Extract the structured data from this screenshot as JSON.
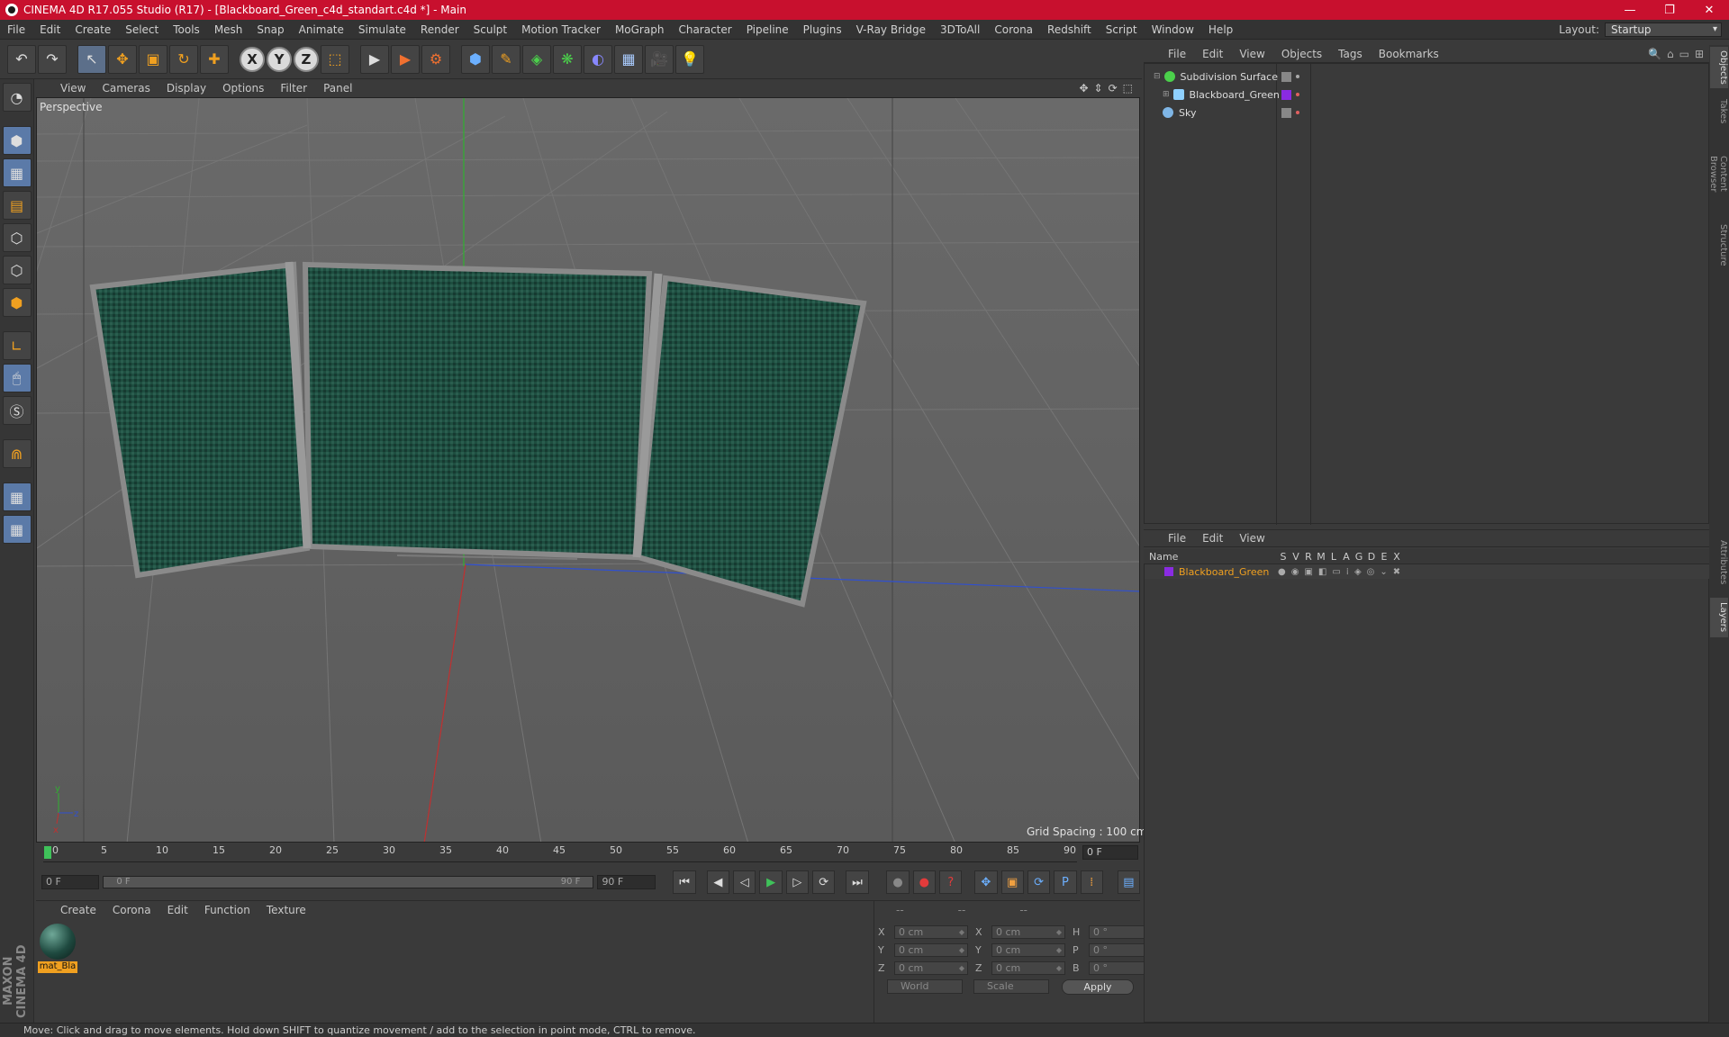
{
  "window": {
    "title": "CINEMA 4D R17.055 Studio (R17) - [Blackboard_Green_c4d_standart.c4d *] - Main",
    "minimize": "—",
    "maximize": "❐",
    "close": "✕"
  },
  "menubar": {
    "items": [
      "File",
      "Edit",
      "Create",
      "Select",
      "Tools",
      "Mesh",
      "Snap",
      "Animate",
      "Simulate",
      "Render",
      "Sculpt",
      "Motion Tracker",
      "MoGraph",
      "Character",
      "Pipeline",
      "Plugins",
      "V-Ray Bridge",
      "3DToAll",
      "Corona",
      "Redshift",
      "Script",
      "Window",
      "Help"
    ],
    "layout_label": "Layout:",
    "layout_value": "Startup"
  },
  "toolbar": {
    "undo": "↶",
    "redo": "↷",
    "select": "↖",
    "move": "✥",
    "scale": "▣",
    "rotate": "↻",
    "live": "✚",
    "x": "X",
    "y": "Y",
    "z": "Z",
    "coord": "⬚",
    "render_view": "▶",
    "render_pic": "▶",
    "render_settings": "⚙",
    "cube": "⬢",
    "pen": "✎",
    "nurbs": "◈",
    "array": "❋",
    "deformer": "◐",
    "floor": "▦",
    "camera": "🎥",
    "light": "💡"
  },
  "viewport": {
    "menu": [
      "View",
      "Cameras",
      "Display",
      "Options",
      "Filter",
      "Panel"
    ],
    "nav_icons": [
      "✥",
      "⇕",
      "⟳",
      "⬚"
    ],
    "label": "Perspective",
    "grid_spacing": "Grid Spacing : 100 cm",
    "axis_y": "y",
    "axis_z": "z",
    "axis_x": "x"
  },
  "timeline": {
    "ticks": [
      "0",
      "5",
      "10",
      "15",
      "20",
      "25",
      "30",
      "35",
      "40",
      "45",
      "50",
      "55",
      "60",
      "65",
      "70",
      "75",
      "80",
      "85",
      "90"
    ],
    "current_frame": "0 F",
    "start_field": "0 F",
    "range_start": "0 F",
    "range_end": "90 F",
    "end_field": "90 F"
  },
  "transport": {
    "first": "⏮",
    "prev_key": "◀",
    "prev": "◁",
    "play": "▶",
    "next": "▷",
    "next_key": "⟳",
    "last": "⏭",
    "record": "●",
    "autokey": "●",
    "help": "?",
    "move_key": "✥",
    "scale_key": "▣",
    "rot_key": "⟳",
    "param_key": "P",
    "pla_key": "⁞",
    "timeline_btn": "▤"
  },
  "materials": {
    "menu": [
      "Create",
      "Corona",
      "Edit",
      "Function",
      "Texture"
    ],
    "items": [
      {
        "label": "mat_Bla"
      }
    ]
  },
  "coords": {
    "head": [
      "--",
      "--",
      "--"
    ],
    "rows": [
      {
        "a": "X",
        "v1": "0 cm",
        "b": "X",
        "v2": "0 cm",
        "c": "H",
        "v3": "0 °"
      },
      {
        "a": "Y",
        "v1": "0 cm",
        "b": "Y",
        "v2": "0 cm",
        "c": "P",
        "v3": "0 °"
      },
      {
        "a": "Z",
        "v1": "0 cm",
        "b": "Z",
        "v2": "0 cm",
        "c": "B",
        "v3": "0 °"
      }
    ],
    "world": "World",
    "scale": "Scale",
    "apply": "Apply"
  },
  "status": "Move: Click and drag to move elements. Hold down SHIFT to quantize movement / add to the selection in point mode, CTRL to remove.",
  "maxon": "MAXON CINEMA 4D",
  "objects": {
    "menu": [
      "File",
      "Edit",
      "View",
      "Objects",
      "Tags",
      "Bookmarks"
    ],
    "icons": [
      "🔍",
      "⌂",
      "▭",
      "⊞"
    ],
    "rows": [
      {
        "name": "Subdivision Surface",
        "color": "#4bd04b"
      },
      {
        "name": "Blackboard_Green",
        "color": "#8fd1ff",
        "tag": "#8a2be2"
      },
      {
        "name": "Sky",
        "color": "#7fb6e6"
      }
    ]
  },
  "layers": {
    "menu": [
      "File",
      "Edit",
      "View"
    ],
    "columns": [
      "Name",
      "S",
      "V",
      "R",
      "M",
      "L",
      "A",
      "G",
      "D",
      "E",
      "X"
    ],
    "rows": [
      {
        "name": "Blackboard_Green",
        "color": "#8a2be2"
      }
    ]
  },
  "sidetabs": [
    "Objects",
    "Takes",
    "Content Browser",
    "Structure",
    "Attributes",
    "Layers"
  ],
  "colors": {
    "titlebar": "#c8102e",
    "board": "#1c4a3c",
    "frame": "#8a8a8a",
    "axis_x": "#c03030",
    "axis_y": "#30b030",
    "axis_z": "#3050d0"
  }
}
